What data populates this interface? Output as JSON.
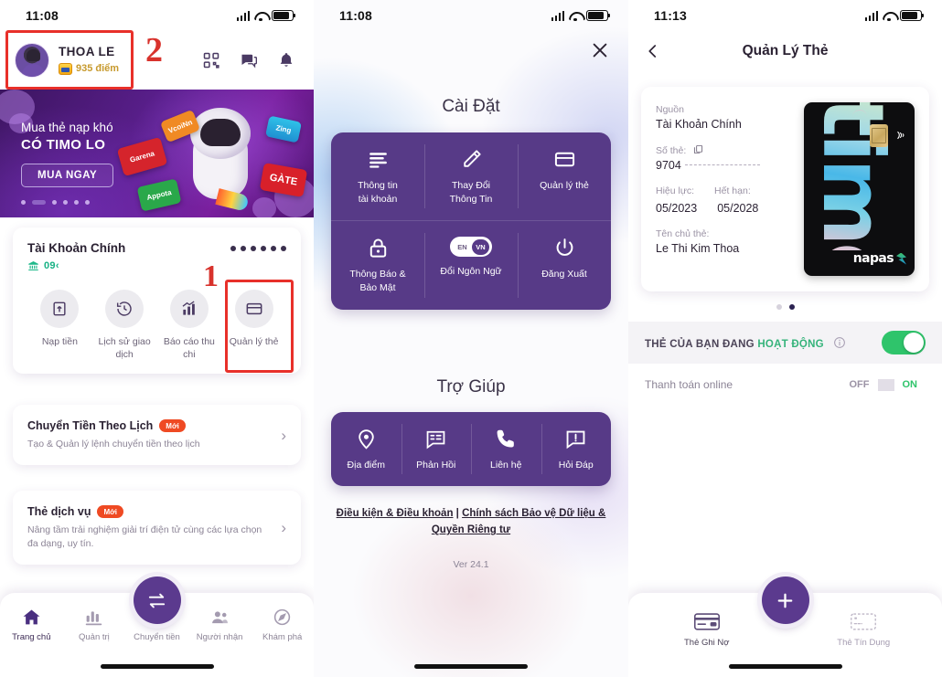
{
  "screens": {
    "home": {
      "status": {
        "time": "11:08"
      },
      "header": {
        "user_name": "THOA LE",
        "points": "935 điểm",
        "icons": [
          "qr-scan-icon",
          "chat-icon",
          "bell-icon"
        ]
      },
      "marker_number": "2",
      "banner": {
        "line1": "Mua thẻ nạp khó",
        "line2": "CÓ TIMO LO",
        "cta": "MUA NGAY",
        "cards": [
          "VcoiNn",
          "Garena",
          "Appota",
          "Zing",
          "GÀTE"
        ],
        "dots": 6,
        "active_dot": 1
      },
      "account": {
        "name": "Tài Khoản Chính",
        "number": "09‹",
        "balance_masked": "●●●●●●",
        "actions": [
          {
            "label": "Nạp tiền",
            "icon": "deposit-icon"
          },
          {
            "label": "Lịch sử\ngiao dịch",
            "icon": "history-icon"
          },
          {
            "label": "Báo cáo\nthu chi",
            "icon": "report-chart-icon"
          },
          {
            "label": "Quản lý\nthẻ",
            "icon": "card-icon"
          }
        ]
      },
      "marker_number_1": "1",
      "promos": [
        {
          "title": "Chuyển Tiền Theo Lịch",
          "badge": "Mới",
          "sub": "Tạo & Quản lý lệnh chuyển tiền theo lịch"
        },
        {
          "title": "Thẻ dịch vụ",
          "badge": "Mới",
          "sub": "Nâng tầm trải nghiệm giải trí điện tử cùng các lựa chọn đa dạng, uy tín."
        }
      ],
      "bottom_nav": [
        {
          "label": "Trang chủ",
          "icon": "home-icon",
          "active": true
        },
        {
          "label": "Quản trị",
          "icon": "bars-chart-icon",
          "active": false
        },
        {
          "label": "Chuyển tiền",
          "icon": "transfer-icon",
          "active": false
        },
        {
          "label": "Người nhận",
          "icon": "recipients-icon",
          "active": false
        },
        {
          "label": "Khám phá",
          "icon": "compass-icon",
          "active": false
        }
      ]
    },
    "settings": {
      "status": {
        "time": "11:08"
      },
      "close_icon": "close-icon",
      "title": "Cài Đặt",
      "items": [
        {
          "label": "Thông tin\ntài khoản",
          "icon": "list-lines-icon"
        },
        {
          "label": "Thay Đổi\nThông Tin",
          "icon": "pencil-icon"
        },
        {
          "label": "Quản lý thẻ",
          "icon": "card-icon",
          "highlighted": true
        },
        {
          "label": "Thông Báo &\nBảo Mật",
          "icon": "lock-icon"
        },
        {
          "label": "Đổi Ngôn Ngữ",
          "icon": "language-toggle-icon",
          "lang_left": "EN",
          "lang_right": "VN"
        },
        {
          "label": "Đăng Xuất",
          "icon": "power-icon"
        }
      ],
      "help_title": "Trợ Giúp",
      "help_items": [
        {
          "label": "Địa điểm",
          "icon": "location-pin-icon"
        },
        {
          "label": "Phản Hồi",
          "icon": "feedback-icon"
        },
        {
          "label": "Liên hệ",
          "icon": "phone-icon"
        },
        {
          "label": "Hỏi Đáp",
          "icon": "faq-icon"
        }
      ],
      "legal_terms": "Điều kiện & Điều khoản",
      "legal_sep": " | ",
      "legal_privacy": "Chính sách Bảo vệ Dữ liệu & Quyền Riêng tư",
      "version": "Ver 24.1"
    },
    "card_mgmt": {
      "status": {
        "time": "11:13"
      },
      "back_icon": "chevron-left-icon",
      "title": "Quản Lý Thẻ",
      "card": {
        "source_label": "Nguồn",
        "source_value": "Tài Khoản Chính",
        "number_label": "Số thẻ:",
        "copy_icon": "copy-icon",
        "number_value": "9704",
        "valid_label": "Hiệu lực:",
        "valid_value": "05/2023",
        "expiry_label": "Hết hạn:",
        "expiry_value": "05/2028",
        "holder_label": "Tên chủ thẻ:",
        "holder_value": "Le Thi Kim Thoa",
        "brand": "timo",
        "network": "napas"
      },
      "pager": {
        "count": 2,
        "active": 1
      },
      "status_prefix": "THẺ CỦA BẠN ĐANG",
      "status_state": "HOẠT ĐỘNG",
      "status_info_icon": "info-icon",
      "toggle_on": true,
      "online_label": "Thanh toán online",
      "online_off": "OFF",
      "online_on": "ON",
      "fab_icon": "plus-icon",
      "bottom_nav": [
        {
          "label": "Thẻ Ghi Nợ",
          "icon": "debit-card-icon",
          "active": true
        },
        {
          "label": "Thẻ Tín Dụng",
          "icon": "credit-card-icon",
          "active": false
        }
      ]
    }
  },
  "colors": {
    "brand_purple": "#573a87",
    "marker_red": "#e8302a",
    "badge_orange": "#ef4a23",
    "green_on": "#2fc46b",
    "teal_account": "#18b184"
  }
}
